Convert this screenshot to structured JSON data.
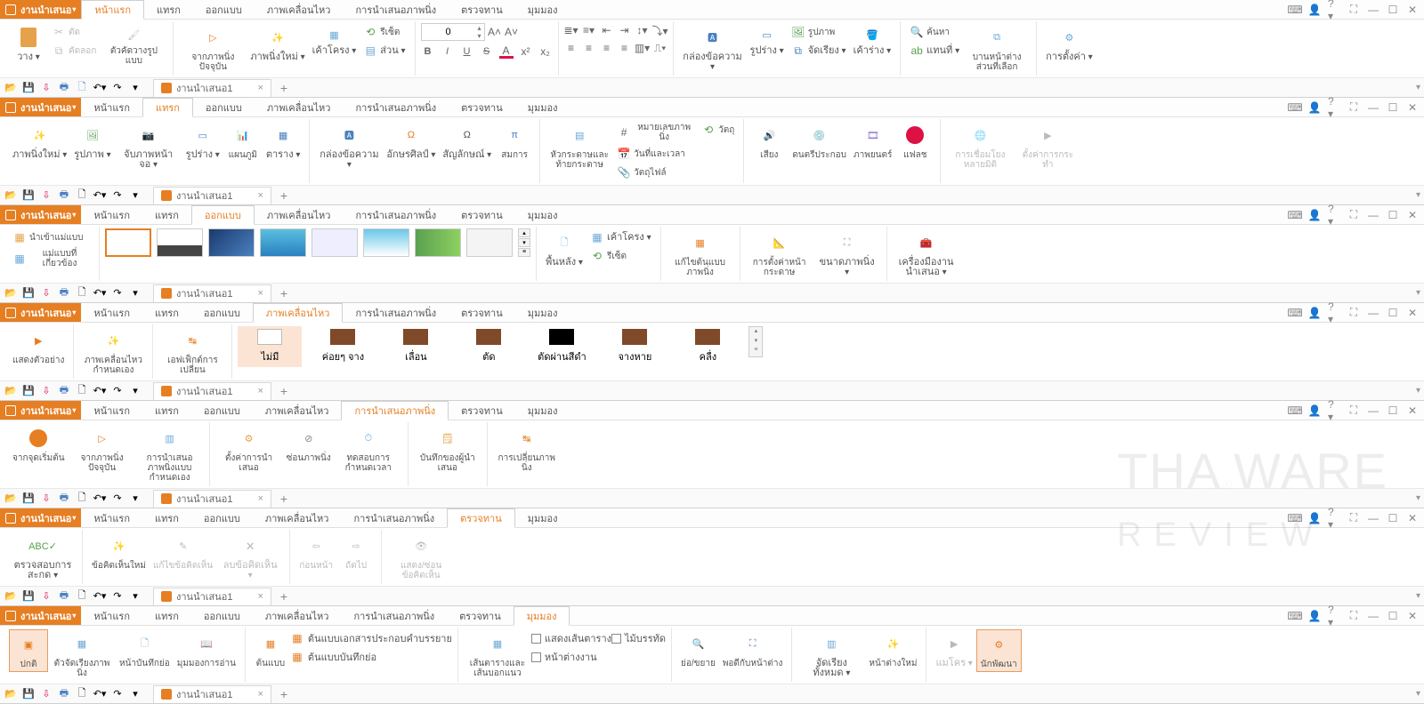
{
  "app_title": "งานนำเสนอ",
  "document_tab": "งานนำเสนอ1",
  "font_size_value": "0",
  "tabs": {
    "file": "งานนำเสนอ",
    "home": "หน้าแรก",
    "insert": "แทรก",
    "design": "ออกแบบ",
    "animation": "ภาพเคลื่อนไหว",
    "slideshow": "การนำเสนอภาพนิ่ง",
    "review": "ตรวจทาน",
    "view": "มุมมอง"
  },
  "home": {
    "cut": "ตัด",
    "copy": "คัดลอก",
    "format_painter": "ตัวคัดวางรูปแบบ",
    "paste": "วาง",
    "from_current": "จากภาพนิ่งปัจจุบัน",
    "new_slide": "ภาพนิ่งใหม่",
    "layout": "เค้าโครง",
    "section": "ส่วน",
    "reset": "รีเซ็ต",
    "text_box": "กล่องข้อความ",
    "shapes": "รูปร่าง",
    "arrange": "จัดเรียง",
    "fill": "เค้าร่าง",
    "picture": "รูปภาพ",
    "icon": "แทน",
    "replace": "แทนที่",
    "find": "ค้นหา",
    "select": "บานหน้าต่างส่วนที่เลือก",
    "settings": "การตั้งค่า"
  },
  "insert": {
    "new_slide": "ภาพนิ่งใหม่",
    "picture": "รูปภาพ",
    "screenshot": "จับภาพหน้าจอ",
    "shapes": "รูปร่าง",
    "chart": "แผนภูมิ",
    "table": "ตาราง",
    "text_box": "กล่องข้อความ",
    "wordart": "อักษรศิลป์",
    "symbol": "สัญลักษณ์",
    "equation": "สมการ",
    "header_footer": "หัวกระดาษและท้ายกระดาษ",
    "slide_number": "หมายเลขภาพนิ่ง",
    "date": "วันที่และเวลา",
    "object": "วัตถุไฟล์",
    "object2": "วัตถุ",
    "audio": "เสียง",
    "music": "ดนตรีประกอบ",
    "video": "ภาพยนตร์",
    "flash": "แฟลช",
    "hyperlink": "การเชื่อมโยงหลายมิติ",
    "action": "ตั้งค่าการกระทำ"
  },
  "design": {
    "import": "นำเข้าแม่แบบ",
    "related": "แม่แบบที่เกี่ยวข้อง",
    "background": "พื้นหลัง",
    "layout": "เค้าโครง",
    "reset": "รีเซ็ต",
    "edit_template": "แก้ไขต้นแบบภาพนิ่ง",
    "page_setup": "การตั้งค่าหน้ากระดาษ",
    "slide_size": "ขนาดภาพนิ่ง",
    "tools": "เครื่องมืองานนำเสนอ"
  },
  "animation": {
    "preview": "แสดงตัวอย่าง",
    "custom": "ภาพเคลื่อนไหวกำหนดเอง",
    "effects": "เอฟเฟ็กต์การเปลี่ยน",
    "none": "ไม่มี",
    "fade": "ค่อยๆ จาง",
    "wipe": "เลื่อน",
    "cut": "ตัด",
    "cut_black": "ตัดผ่านสีดำ",
    "dissolve": "จางหาย",
    "wedge": "คลื่ง"
  },
  "slideshow": {
    "from_start": "จากจุดเริ่มต้น",
    "from_current": "จากภาพนิ่งปัจจุบัน",
    "custom_show": "การนำเสนอภาพนิ่งแบบกำหนดเอง",
    "setup": "ตั้งค่าการนำเสนอ",
    "hide": "ซ่อนภาพนิ่ง",
    "rehearse": "ทดสอบการกำหนดเวลา",
    "presenter": "บันทึกของผู้นำเสนอ",
    "switch": "การเปลี่ยนภาพนิ่ง"
  },
  "review": {
    "spellcheck": "ตรวจสอบการสะกด",
    "new_comment": "ข้อคิดเห็นใหม่",
    "edit_comment": "แก้ไขข้อคิดเห็น",
    "delete_comment": "ลบข้อคิดเห็น",
    "previous": "ก่อนหน้า",
    "next": "ถัดไป",
    "show_hide": "แสดง/ซ่อนข้อคิดเห็น"
  },
  "view": {
    "normal": "ปกติ",
    "outline": "ตัวจัดเรียงภาพนิ่ง",
    "page": "หน้าบันทึกย่อ",
    "view": "มุมมองการอ่าน",
    "master": "ต้นแบบ",
    "handout_master": "ต้นแบบเอกสารประกอบคำบรรยาย",
    "notes_master": "ต้นแบบบันทึกย่อ",
    "ruler": "ไม้บรรทัด",
    "gridlines": "แสดงเส้นตาราง",
    "guides": "เส้นตารางและเส้นบอกแนว",
    "blank": "หน้าต่างงาน",
    "zoom": "ย่อ/ขยาย",
    "fit": "พอดีกับหน้าต่าง",
    "arrange": "จัดเรียงทั้งหมด",
    "new_window": "หน้าต่างใหม่",
    "macro": "แมโคร",
    "developer": "นักพัฒนา"
  }
}
